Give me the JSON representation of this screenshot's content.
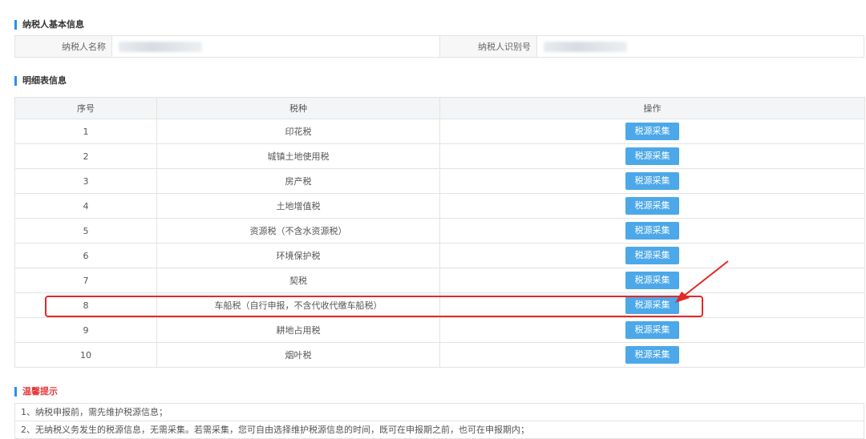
{
  "basic_section": {
    "title": "纳税人基本信息",
    "name_label": "纳税人名称",
    "id_label": "纳税人识别号"
  },
  "detail_section": {
    "title": "明细表信息",
    "headers": [
      "序号",
      "税种",
      "操作"
    ],
    "button_label": "税源采集",
    "rows": [
      {
        "no": "1",
        "tax": "印花税"
      },
      {
        "no": "2",
        "tax": "城镇土地使用税"
      },
      {
        "no": "3",
        "tax": "房产税"
      },
      {
        "no": "4",
        "tax": "土地增值税"
      },
      {
        "no": "5",
        "tax": "资源税（不含水资源税）"
      },
      {
        "no": "6",
        "tax": "环境保护税"
      },
      {
        "no": "7",
        "tax": "契税"
      },
      {
        "no": "8",
        "tax": "车船税（自行申报，不含代收代缴车船税）"
      },
      {
        "no": "9",
        "tax": "耕地占用税"
      },
      {
        "no": "10",
        "tax": "烟叶税"
      }
    ]
  },
  "tips_section": {
    "title": "温馨提示",
    "items": [
      "1、纳税申报前，需先维护税源信息；",
      "2、无纳税义务发生的税源信息，无需采集。若需采集，您可自由选择维护税源信息的时间，既可在申报期之前，也可在申报期内；"
    ]
  },
  "annotation": {
    "highlighted_row": "8",
    "color": "#e22828"
  }
}
